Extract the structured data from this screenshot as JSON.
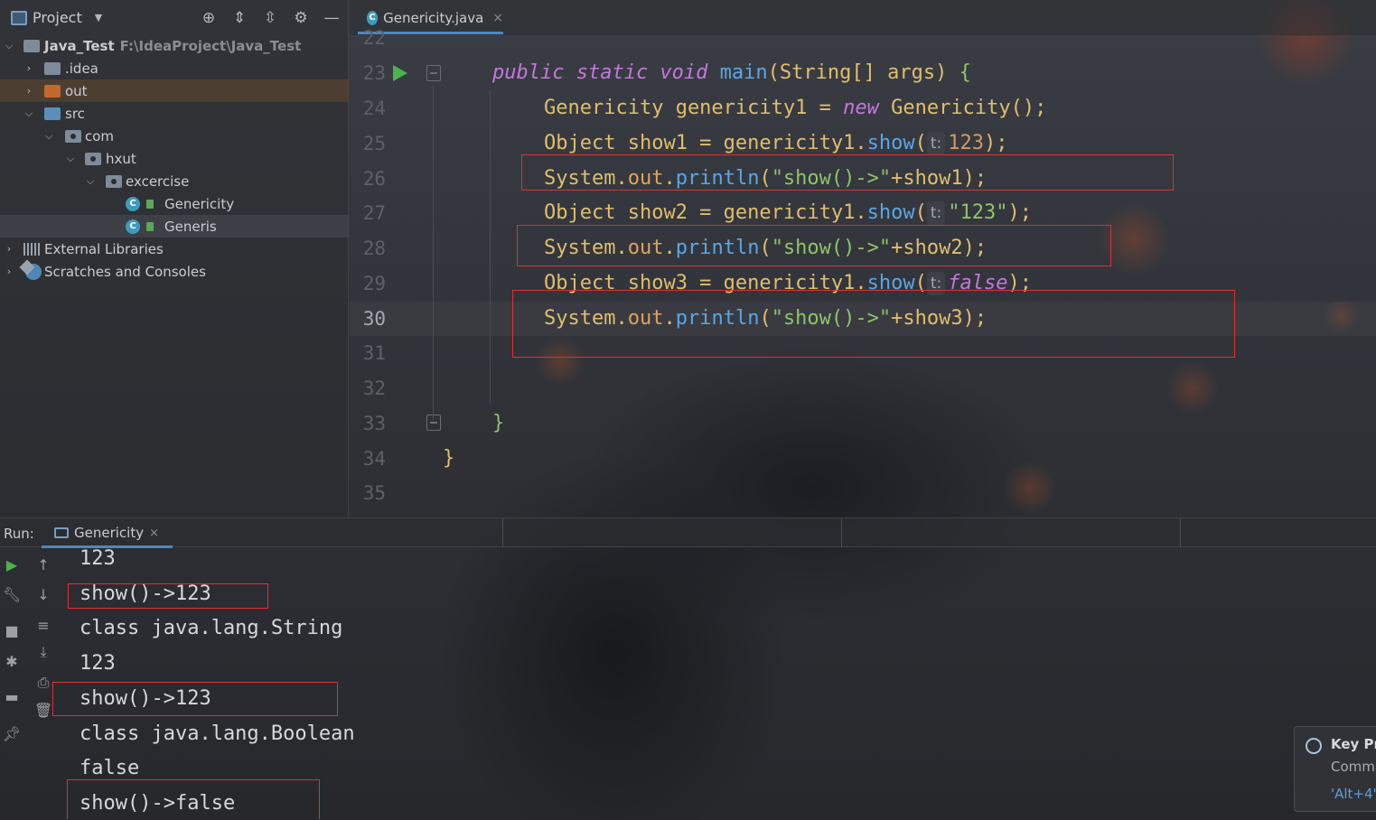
{
  "project_panel": {
    "title": "Project",
    "tree": [
      {
        "label": "Java_Test",
        "path": "F:\\IdeaProject\\Java_Test"
      },
      {
        "label": ".idea"
      },
      {
        "label": "out"
      },
      {
        "label": "src"
      },
      {
        "label": "com"
      },
      {
        "label": "hxut"
      },
      {
        "label": "excercise"
      },
      {
        "label": "Genericity"
      },
      {
        "label": "Generis"
      },
      {
        "label": "External Libraries"
      },
      {
        "label": "Scratches and Consoles"
      }
    ]
  },
  "editor": {
    "tab_label": "Genericity.java",
    "tab_close": "×",
    "line_numbers": [
      "22",
      "23",
      "24",
      "25",
      "26",
      "27",
      "28",
      "29",
      "30",
      "31",
      "32",
      "33",
      "34",
      "35"
    ],
    "hint": "t:",
    "code": {
      "l23": {
        "a": "public static void",
        "b": "main",
        "c": "(String[] args) ",
        "d": "{"
      },
      "l24": {
        "a": "Genericity genericity1 = ",
        "b": "new",
        "c": " Genericity();"
      },
      "l25": {
        "a": "Object show1 = genericity1.",
        "b": "show",
        "c": "(",
        "d": "123",
        "e": ");"
      },
      "l26": {
        "a": "System.",
        "b": "out",
        "c": ".",
        "d": "println",
        "e": "(",
        "f": "\"show()->\"",
        "g": "+show1);"
      },
      "l27": {
        "a": "Object show2 = genericity1.",
        "b": "show",
        "c": "(",
        "d": "\"123\"",
        "e": ");"
      },
      "l28": {
        "a": "System.",
        "b": "out",
        "c": ".",
        "d": "println",
        "e": "(",
        "f": "\"show()->\"",
        "g": "+show2);"
      },
      "l29": {
        "a": "Object show3 = genericity1.",
        "b": "show",
        "c": "(",
        "d": "false",
        "e": ");"
      },
      "l30": {
        "a": "System.",
        "b": "out",
        "c": ".",
        "d": "println",
        "e": "(",
        "f": "\"show()->\"",
        "g": "+show3);"
      },
      "l33": "}",
      "l34": "}"
    }
  },
  "run_panel": {
    "label": "Run:",
    "tab_label": "Genericity",
    "tab_close": "×",
    "output": [
      "123",
      "show()->123",
      "class java.lang.String",
      "123",
      "show()->123",
      "class java.lang.Boolean",
      "false",
      "show()->false"
    ]
  },
  "notification": {
    "title": "Key Pr",
    "line1": "Comma",
    "line2": "'Alt+4'"
  },
  "colors": {
    "accent": "#4a88c7",
    "highlight_box": "#e03030",
    "run_green": "#4bb34b"
  }
}
